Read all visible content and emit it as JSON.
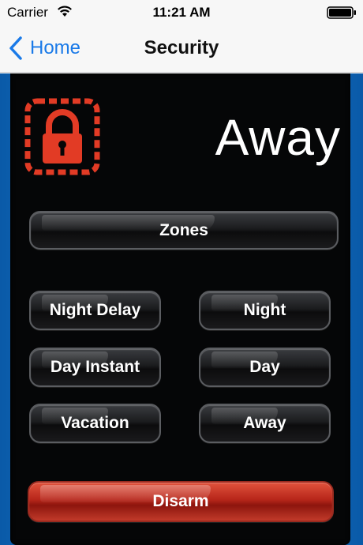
{
  "status_bar": {
    "carrier": "Carrier",
    "time": "11:21 AM"
  },
  "nav": {
    "back_label": "Home",
    "title": "Security"
  },
  "security": {
    "mode": "Away",
    "zones_label": "Zones",
    "arm_buttons": [
      "Night Delay",
      "Night",
      "Day Instant",
      "Day",
      "Vacation",
      "Away"
    ],
    "disarm_label": "Disarm"
  },
  "colors": {
    "accent": "#1a7ae8",
    "lock": "#e23b25",
    "disarm": "#b7261a",
    "background": "#050607"
  }
}
